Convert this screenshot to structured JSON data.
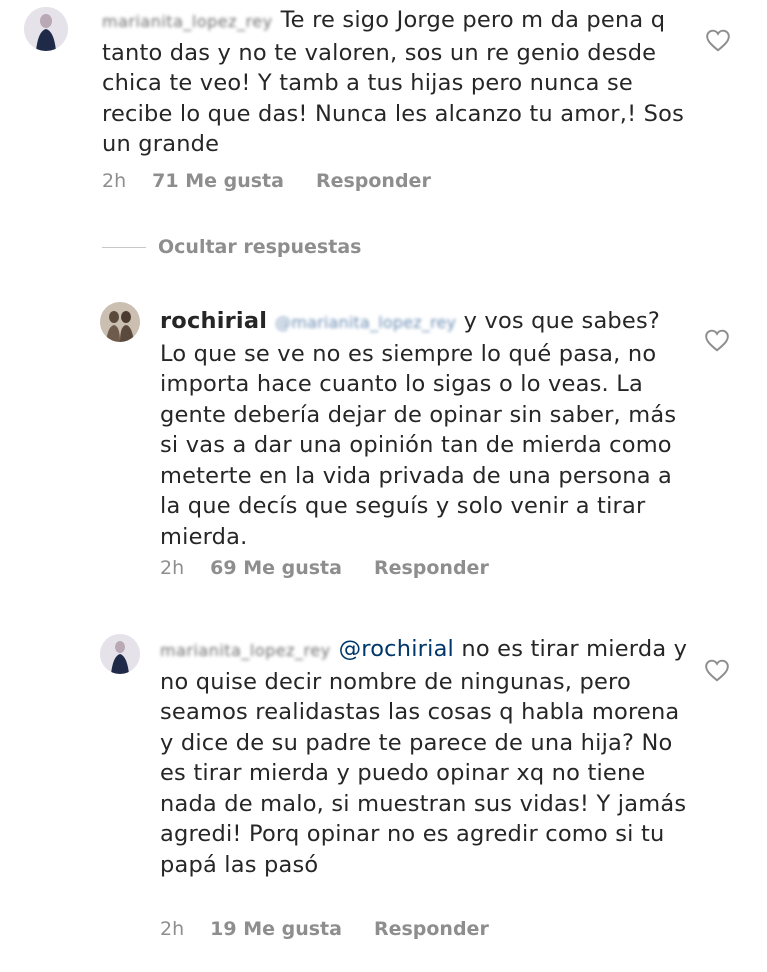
{
  "comments": [
    {
      "username": "marianita_lopez_rey",
      "text": "Te re sigo Jorge pero m da pena q tanto das y no te valoren, sos un re genio desde chica te veo! Y tamb a tus hijas pero nunca se recibe lo que das! Nunca les alcanzo tu amor,! Sos un grande",
      "time": "2h",
      "likes": "71 Me gusta",
      "reply": "Responder"
    },
    {
      "username": "rochirial",
      "mention": "@marianita_lopez_rey",
      "text": "y vos que sabes? Lo que se ve no es siempre lo qué pasa, no importa hace cuanto lo sigas o lo veas. La gente debería dejar de opinar sin saber, más si vas a dar una opinión tan de mierda como meterte en la vida privada de una persona a la que decís que seguís y solo venir a tirar mierda.",
      "time": "2h",
      "likes": "69 Me gusta",
      "reply": "Responder"
    },
    {
      "username": "marianita_lopez_rey",
      "mention": "@rochirial",
      "text": "no es tirar mierda y no quise decir nombre de ningunas, pero seamos realidastas las cosas q habla morena y dice de su padre te parece de una hija? No es tirar mierda y puedo opinar xq no tiene nada de malo, si muestran sus vidas! Y jamás agredi! Porq opinar no es agredir como si tu papá las pasó",
      "time": "2h",
      "likes": "19 Me gusta",
      "reply": "Responder"
    }
  ],
  "replies_toggle": "Ocultar respuestas",
  "colors": {
    "text": "#262626",
    "meta": "#8e8e8e",
    "mention": "#00376b",
    "heart_stroke": "#8e8e8e"
  },
  "icons": {
    "like": "heart-outline-icon"
  }
}
